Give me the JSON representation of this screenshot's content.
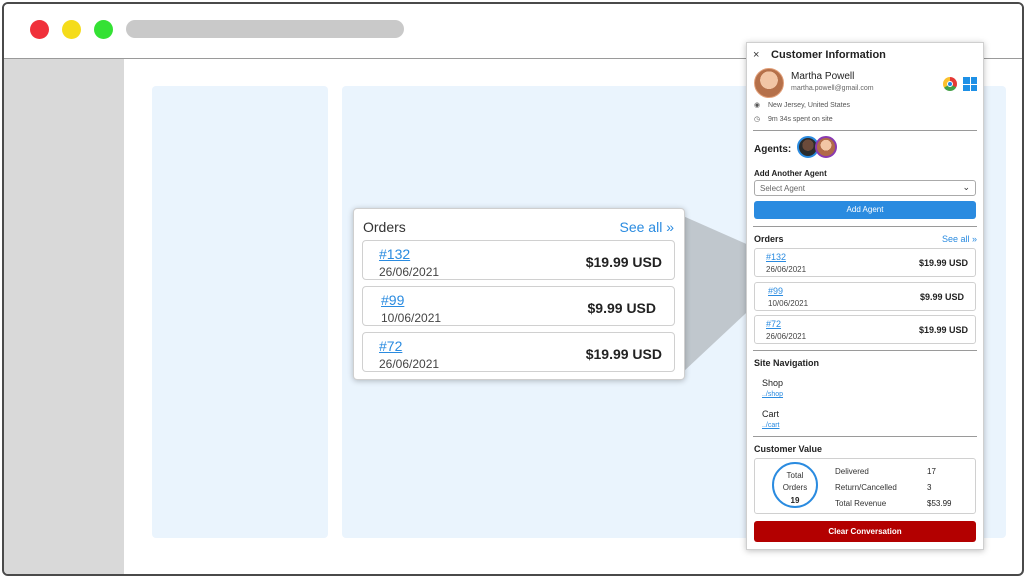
{
  "zoom_orders": {
    "title": "Orders",
    "see_all": "See all",
    "see_all_icon": "double-chevron-right-icon",
    "items": [
      {
        "id": "#132",
        "date": "26/06/2021",
        "price": "$19.99 USD"
      },
      {
        "id": "#99",
        "date": "10/06/2021",
        "price": "$9.99 USD"
      },
      {
        "id": "#72",
        "date": "26/06/2021",
        "price": "$19.99 USD"
      }
    ]
  },
  "panel": {
    "close": "×",
    "title": "Customer Information",
    "customer": {
      "name": "Martha Powell",
      "email": "martha.powell@gmail.com",
      "location": "New Jersey, United States",
      "time_on_site": "9m 34s spent on site"
    },
    "icons": {
      "browser": "chrome-icon",
      "os": "windows-icon"
    },
    "agents_label": "Agents:",
    "add_agent_label": "Add Another Agent",
    "select_placeholder": "Select Agent",
    "add_agent_button": "Add Agent",
    "orders_title": "Orders",
    "orders_see_all": "See all",
    "orders": [
      {
        "id": "#132",
        "date": "26/06/2021",
        "price": "$19.99 USD"
      },
      {
        "id": "#99",
        "date": "10/06/2021",
        "price": "$9.99 USD"
      },
      {
        "id": "#72",
        "date": "26/06/2021",
        "price": "$19.99 USD"
      }
    ],
    "site_nav_title": "Site Navigation",
    "site_nav": [
      {
        "label": "Shop",
        "link": "../shop"
      },
      {
        "label": "Cart",
        "link": "../cart"
      }
    ],
    "customer_value_title": "Customer Value",
    "total_orders": {
      "line1": "Total",
      "line2": "Orders",
      "value": "19"
    },
    "stats": [
      {
        "label": "Delivered",
        "value": "17"
      },
      {
        "label": "Return/Cancelled",
        "value": "3"
      },
      {
        "label": "Total Revenue",
        "value": "$53.99"
      }
    ],
    "clear_button": "Clear Conversation"
  },
  "colors": {
    "accent": "#2a8be0",
    "danger": "#b30000",
    "content_bg": "#eaf4fd",
    "sidebar_bg": "#d9d9d9",
    "window_red": "#f0303a",
    "window_yellow": "#f5dc1a",
    "window_green": "#34e134"
  }
}
